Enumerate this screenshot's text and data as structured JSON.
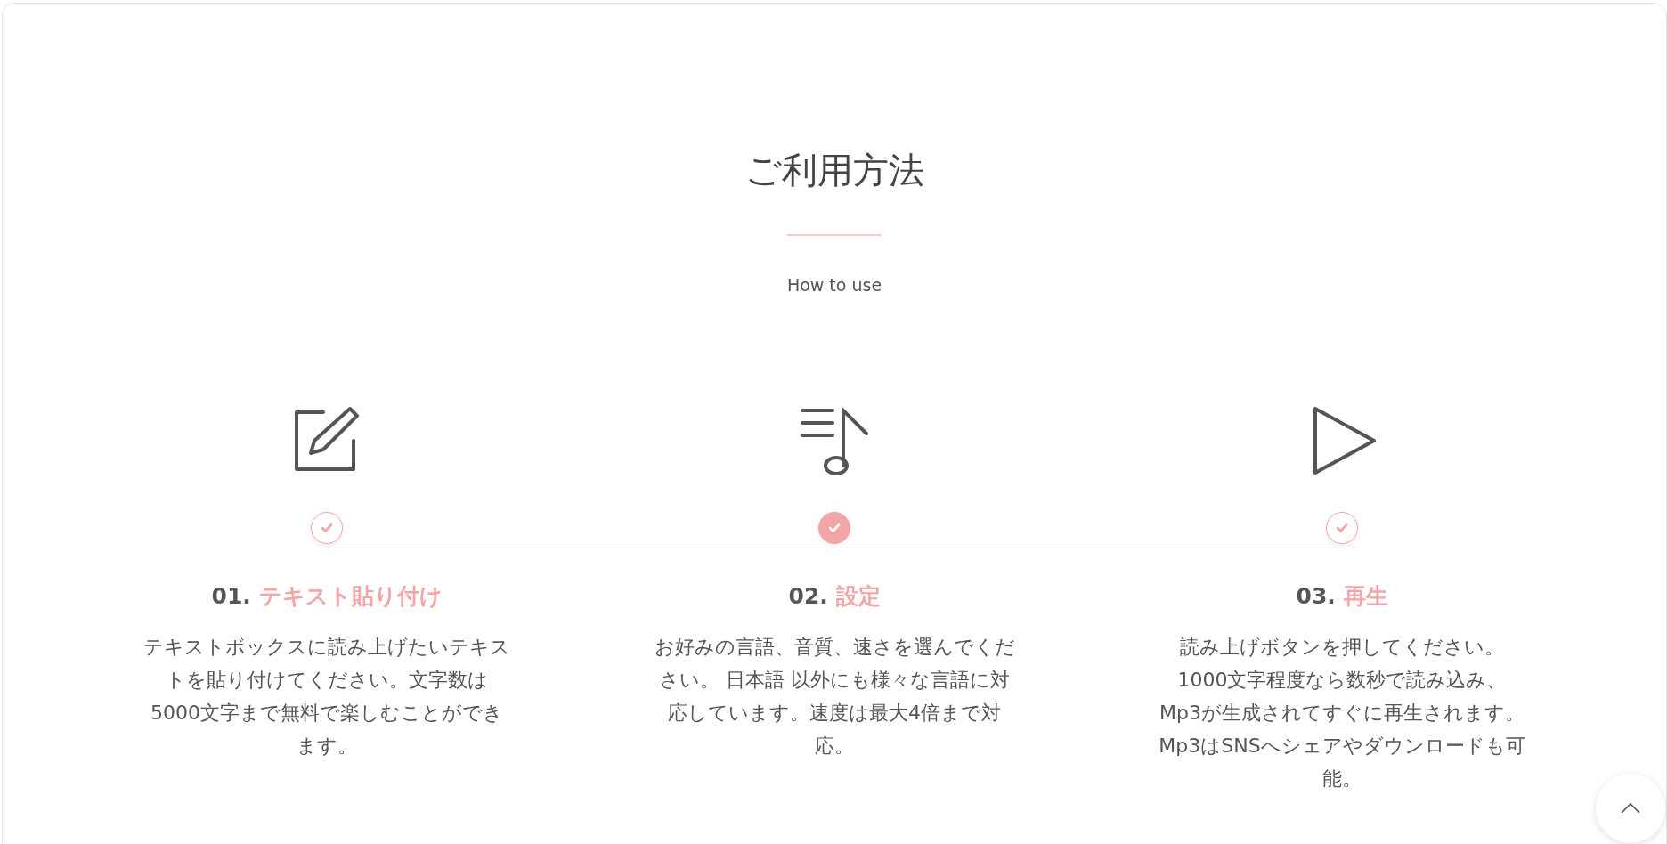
{
  "section": {
    "title": "ご利用方法",
    "subtitle": "How to use"
  },
  "steps": [
    {
      "kind": "edit",
      "number": "01.",
      "title": "テキスト貼り付け",
      "selected": false,
      "text": "テキストボックスに読み上げたいテキストを貼り付けてください。文字数は5000文字まで無料で楽しむことができます。"
    },
    {
      "kind": "music",
      "number": "02.",
      "title": "設定",
      "selected": true,
      "text": "お好みの言語、音質、速さを選んでください。 日本語 以外にも様々な言語に対応しています。速度は最大4倍まで対応。"
    },
    {
      "kind": "play",
      "number": "03.",
      "title": "再生",
      "selected": false,
      "text": "読み上げボタンを押してください。1000文字程度なら数秒で読み込み、Mp3が生成されてすぐに再生されます。Mp3はSNSへシェアやダウンロードも可能。"
    }
  ]
}
